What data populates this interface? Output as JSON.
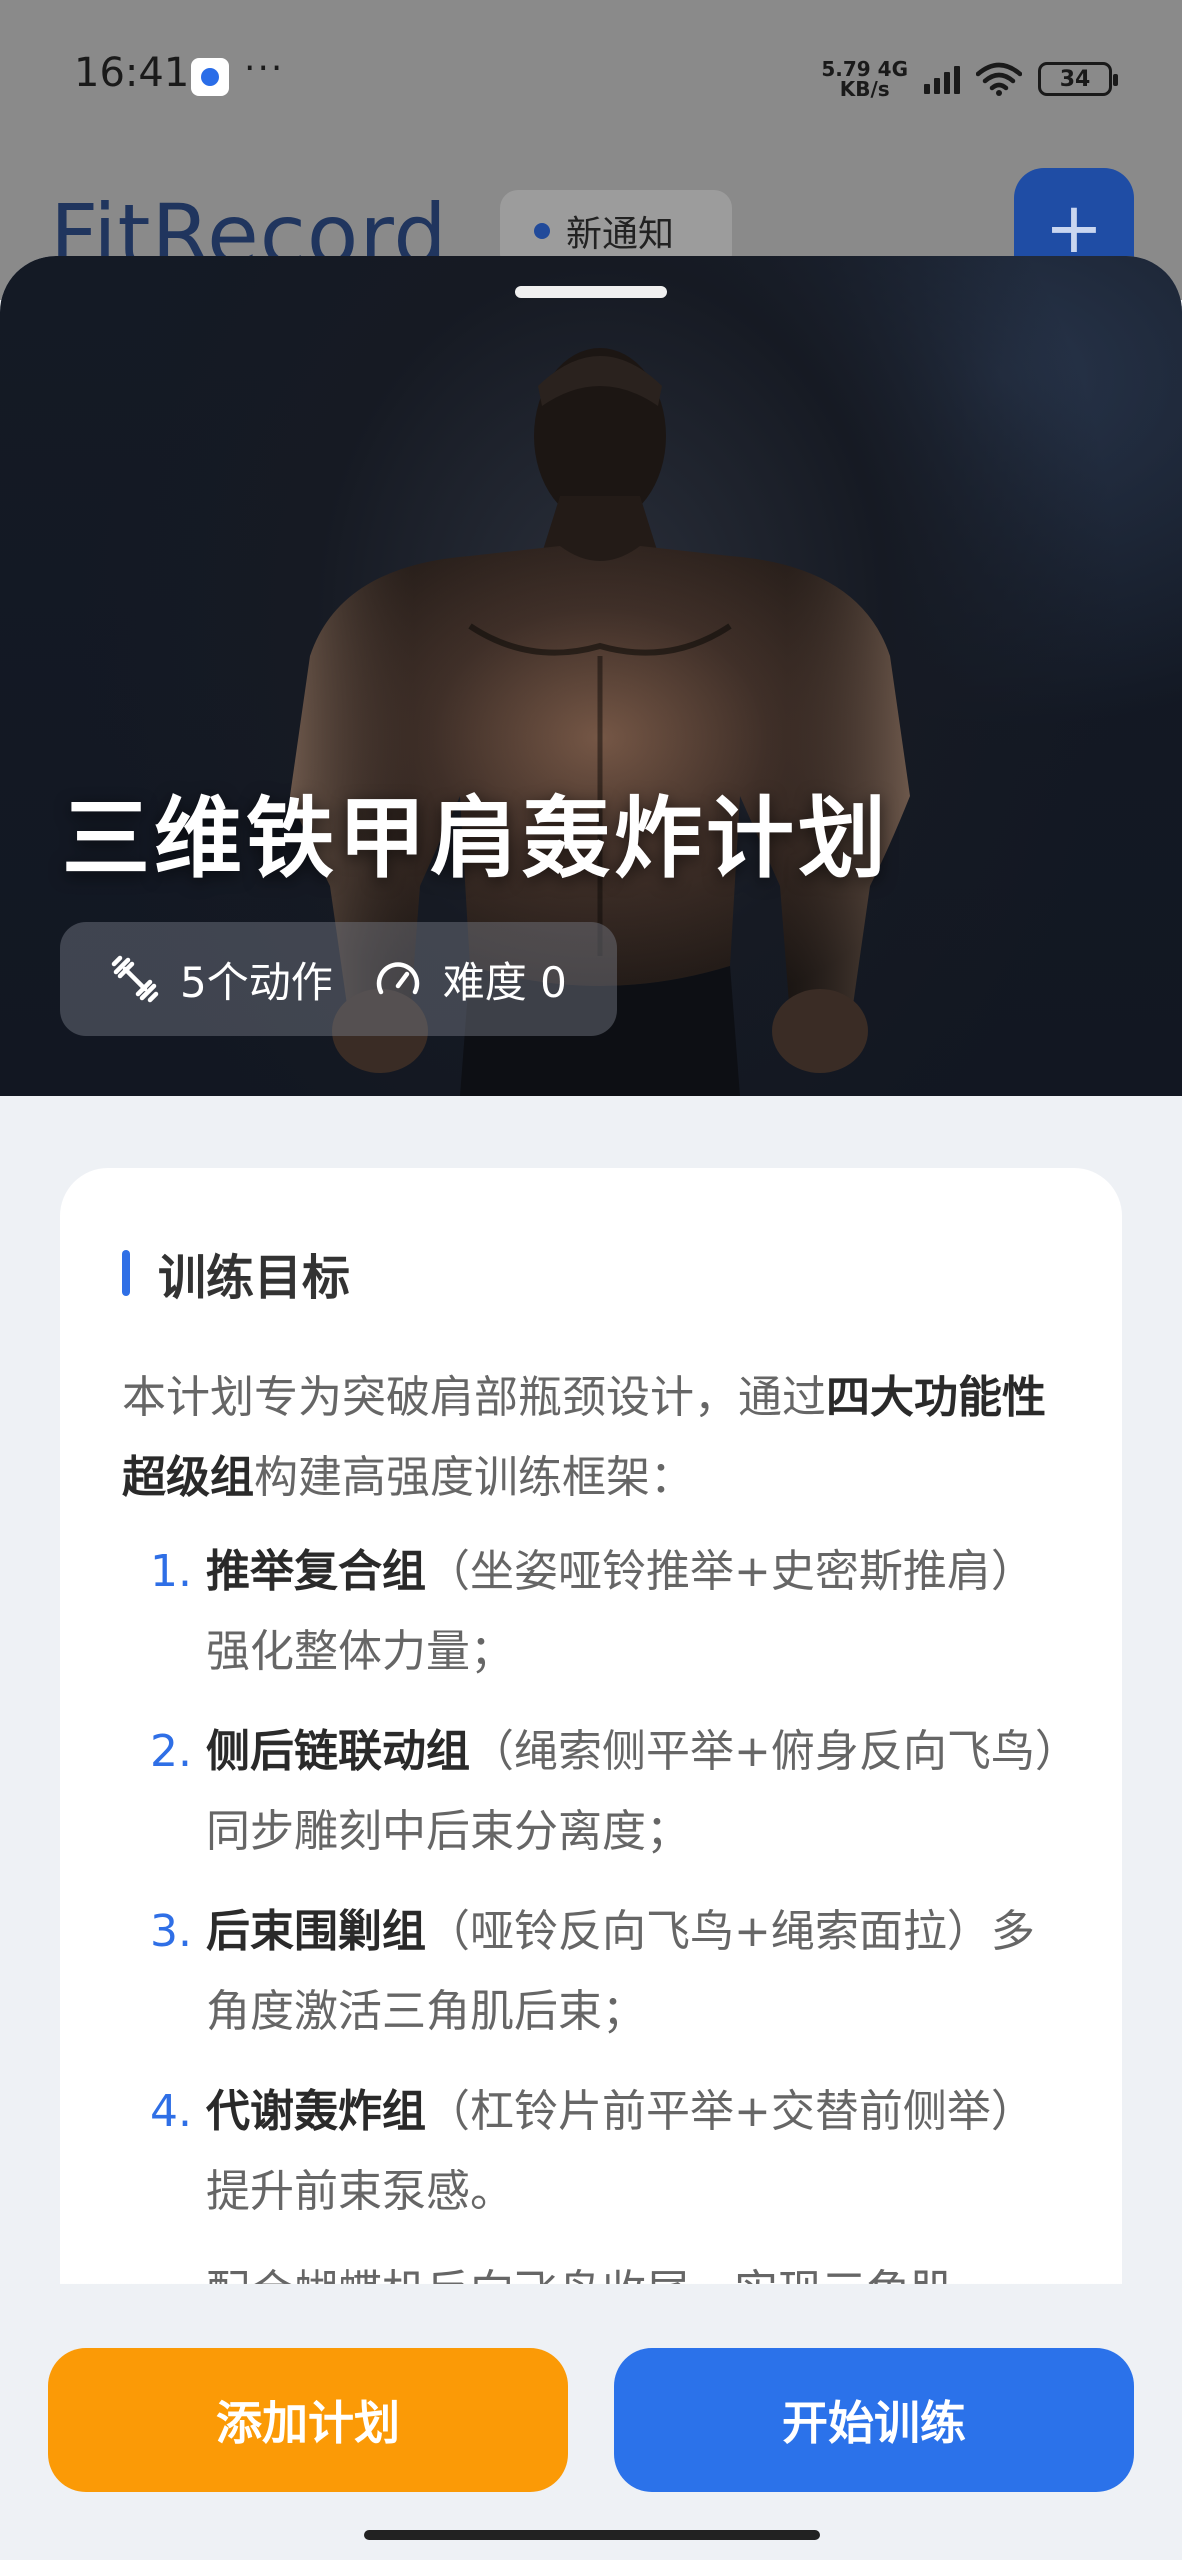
{
  "status_bar": {
    "time": "16:41",
    "more": "···",
    "net_speed_top": "5.79 4G",
    "net_speed_bottom": "KB/s",
    "battery": "34"
  },
  "background_page": {
    "logo": "FitRecord",
    "notice_label": "新通知",
    "add_button": "+"
  },
  "plan": {
    "title": "三维铁甲肩轰炸计划",
    "exercise_count": "5个动作",
    "difficulty": "难度 0",
    "icons": {
      "exercise": "dumbbell-icon",
      "difficulty": "gauge-icon"
    }
  },
  "goal_section": {
    "heading": "训练目标",
    "intro_prefix": "本计划专为突破肩部瓶颈设计，通过",
    "intro_bold": "四大功能性超级组",
    "intro_suffix": "构建高强度训练框架：",
    "steps": [
      {
        "num": "1.",
        "name": "推举复合组",
        "detail": "（坐姿哑铃推举+史密斯推肩）强化整体力量；"
      },
      {
        "num": "2.",
        "name": "侧后链联动组",
        "detail": "（绳索侧平举+俯身反向飞鸟）同步雕刻中后束分离度；"
      },
      {
        "num": "3.",
        "name": "后束围剿组",
        "detail": "（哑铃反向飞鸟+绳索面拉）多角度激活三角肌后束；"
      },
      {
        "num": "4.",
        "name": "代谢轰炸组",
        "detail": "（杠铃片前平举+交替前侧举）提升前束泵感。"
      }
    ],
    "tail": "配合蝴蝶机反向飞鸟收尾，实现三角肌"
  },
  "actions": {
    "add_plan": "添加计划",
    "start_training": "开始训练"
  },
  "colors": {
    "accent_blue": "#2b72ea",
    "accent_orange": "#fb9a06",
    "page_bg": "#eef1f5"
  }
}
